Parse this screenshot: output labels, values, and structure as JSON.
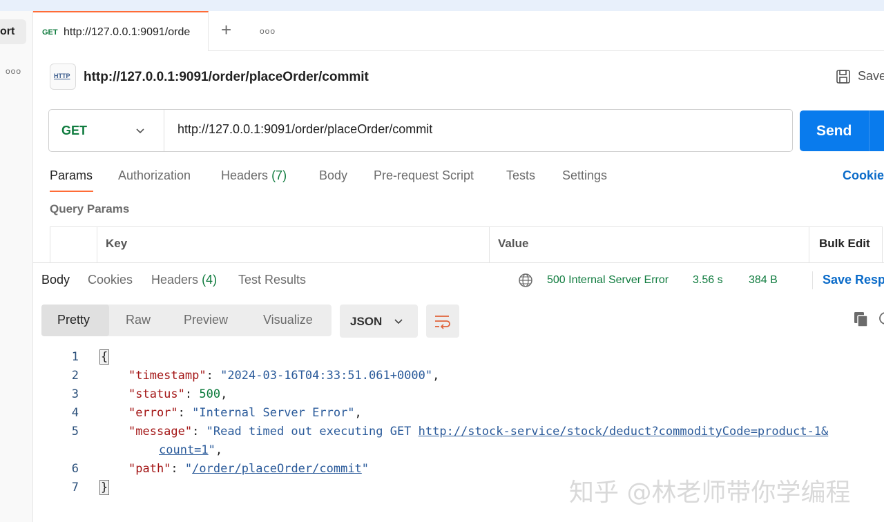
{
  "sidebar": {
    "tab_label": "ort",
    "more": "ooo"
  },
  "tabbar": {
    "active_tab": {
      "method": "GET",
      "url": "http://127.0.0.1:9091/orde"
    },
    "add": "+",
    "more": "ooo"
  },
  "request": {
    "title": "http://127.0.0.1:9091/order/placeOrder/commit",
    "save_label": "Save",
    "method": "GET",
    "url": "http://127.0.0.1:9091/order/placeOrder/commit",
    "send_label": "Send",
    "tabs": [
      {
        "label": "Params"
      },
      {
        "label": "Authorization"
      },
      {
        "label": "Headers",
        "count": "(7)"
      },
      {
        "label": "Body"
      },
      {
        "label": "Pre-request Script"
      },
      {
        "label": "Tests"
      },
      {
        "label": "Settings"
      }
    ],
    "cookies_link": "Cookie",
    "query_params_title": "Query Params",
    "table_headers": {
      "key": "Key",
      "value": "Value",
      "bulk_edit": "Bulk Edit"
    }
  },
  "response": {
    "tabs": [
      {
        "label": "Body"
      },
      {
        "label": "Cookies"
      },
      {
        "label": "Headers",
        "count": "(4)"
      },
      {
        "label": "Test Results"
      }
    ],
    "status": "500 Internal Server Error",
    "time": "3.56 s",
    "size": "384 B",
    "save_response": "Save Response",
    "formats": [
      "Pretty",
      "Raw",
      "Preview",
      "Visualize"
    ],
    "language": "JSON",
    "code": {
      "open_brace": "{",
      "close_brace": "}",
      "timestamp_key": "\"timestamp\"",
      "timestamp_val": "\"2024-03-16T04:33:51.061+0000\"",
      "status_key": "\"status\"",
      "status_val": "500",
      "error_key": "\"error\"",
      "error_val": "\"Internal Server Error\"",
      "message_key": "\"message\"",
      "message_prefix": "\"Read timed out executing GET ",
      "message_link_1": "http://stock-service/stock/deduct?commodityCode=product-1&",
      "message_link_2": "count=1",
      "message_suffix": "\"",
      "path_key": "\"path\"",
      "path_open": "\"",
      "path_link": "/order/placeOrder/commit",
      "path_close": "\"",
      "line_numbers": [
        "1",
        "2",
        "3",
        "4",
        "5",
        "6",
        "7"
      ]
    }
  },
  "watermark": "知乎 @林老师带你学编程",
  "colors": {
    "accent": "#ff6c37",
    "send": "#097bed",
    "success_green": "#0f7b3e",
    "link_blue": "#0a6bc9"
  }
}
